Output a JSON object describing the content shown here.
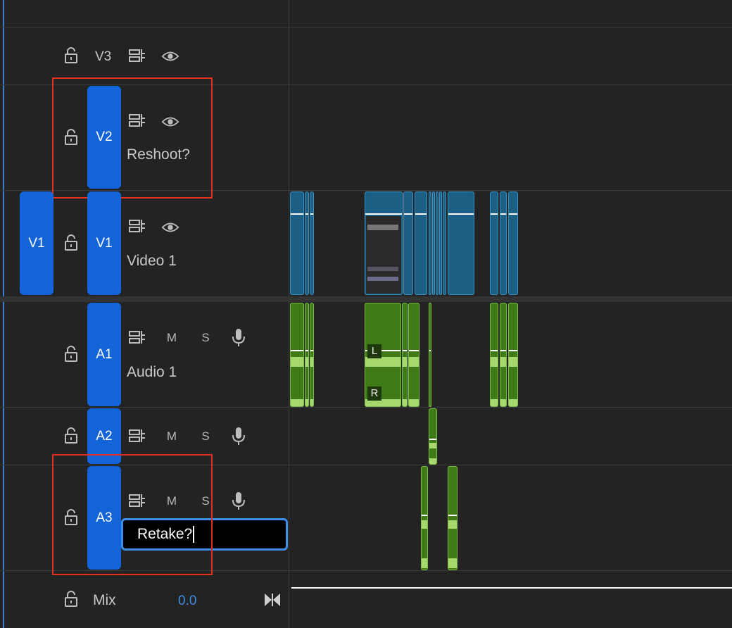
{
  "tracks": {
    "v3": {
      "id": "V3"
    },
    "v2": {
      "id": "V2",
      "name": "Reshoot?"
    },
    "v1": {
      "source": "V1",
      "id": "V1",
      "name": "Video 1"
    },
    "a1": {
      "id": "A1",
      "name": "Audio 1",
      "mute": "M",
      "solo": "S"
    },
    "a2": {
      "id": "A2",
      "mute": "M",
      "solo": "S"
    },
    "a3": {
      "id": "A3",
      "mute": "M",
      "solo": "S",
      "rename_value": "Retake?"
    },
    "mix": {
      "label": "Mix",
      "value": "0.0"
    }
  },
  "clip_tags": {
    "left": "L",
    "right": "R"
  },
  "colors": {
    "track_target": "#1264d8",
    "video_clip": "#1b5f84",
    "audio_clip": "#3e7a16",
    "highlight": "#e0301e",
    "edit_border": "#3d8ee6"
  }
}
